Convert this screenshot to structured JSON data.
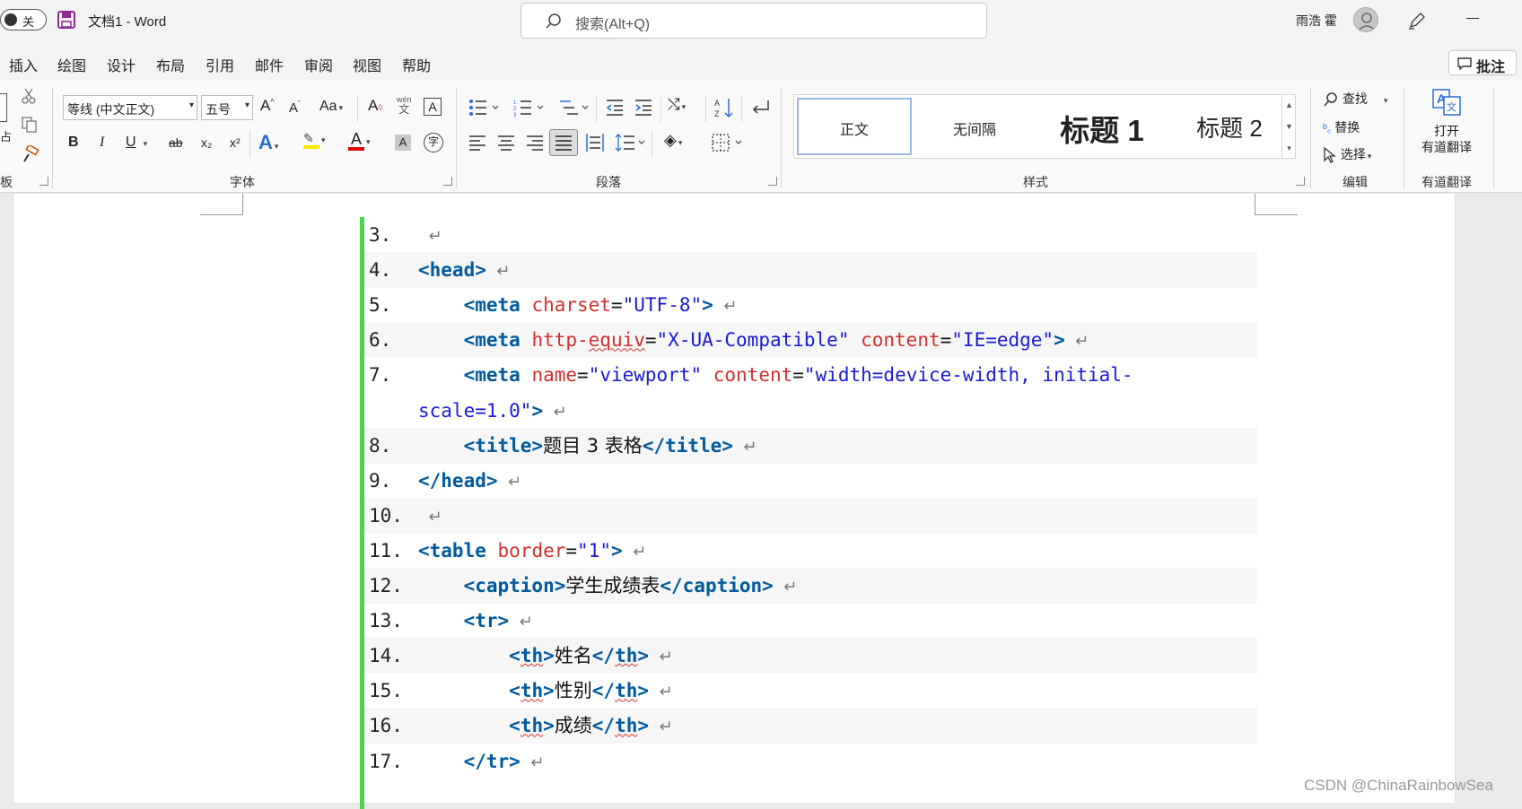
{
  "titlebar": {
    "autosave_label": "关",
    "doc_title": "文档1  -  Word",
    "search_placeholder": "搜索(Alt+Q)",
    "user_name": "雨浩 霍"
  },
  "tabs": [
    "插入",
    "绘图",
    "设计",
    "布局",
    "引用",
    "邮件",
    "审阅",
    "视图",
    "帮助"
  ],
  "comment_button": "批注",
  "ribbon": {
    "clipboard_label": "板",
    "clipboard_paste_fragment": "占",
    "font_group_label": "字体",
    "font_name": "等线 (中文正文)",
    "font_size": "五号",
    "change_case": "Aa",
    "bold": "B",
    "italic": "I",
    "underline": "U",
    "strike": "ab",
    "subscript": "x₂",
    "superscript": "x²",
    "phonetic_top": "wén",
    "phonetic_bottom": "文",
    "paragraph_group_label": "段落",
    "styles_group_label": "样式",
    "styles": [
      "正文",
      "无间隔",
      "标题 1",
      "标题 2"
    ],
    "find": "查找",
    "replace": "替换",
    "select": "选择",
    "editing_group_label": "编辑",
    "translate_line1": "打开",
    "translate_line2": "有道翻译",
    "translate_group_label": "有道翻译"
  },
  "code_lines": [
    {
      "n": "3.",
      "alt": false,
      "parts": []
    },
    {
      "n": "4.",
      "alt": true,
      "parts": [
        [
          "tg",
          "<head>"
        ]
      ]
    },
    {
      "n": "5.",
      "alt": false,
      "parts": [
        [
          "",
          "    "
        ],
        [
          "tg",
          "<meta "
        ],
        [
          "at",
          "charset"
        ],
        [
          "",
          "="
        ],
        [
          "vl",
          "\"UTF-8\""
        ],
        [
          "tg",
          ">"
        ]
      ]
    },
    {
      "n": "6.",
      "alt": true,
      "parts": [
        [
          "",
          "    "
        ],
        [
          "tg",
          "<meta "
        ],
        [
          "at",
          "http-"
        ],
        [
          "at sq",
          "equiv"
        ],
        [
          "",
          "="
        ],
        [
          "vl",
          "\"X-UA-Compatible\" "
        ],
        [
          "at",
          "content"
        ],
        [
          "",
          "="
        ],
        [
          "vl",
          "\"IE=edge\""
        ],
        [
          "tg",
          ">"
        ]
      ]
    },
    {
      "n": "7.",
      "alt": false,
      "parts": [
        [
          "",
          "    "
        ],
        [
          "tg",
          "<meta "
        ],
        [
          "at",
          "name"
        ],
        [
          "",
          "="
        ],
        [
          "vl",
          "\"viewport\" "
        ],
        [
          "at",
          "content"
        ],
        [
          "",
          "="
        ],
        [
          "vl",
          "\"width=device-width, initial-"
        ]
      ],
      "noret": true
    },
    {
      "n": "",
      "alt": false,
      "parts": [
        [
          "vl",
          "scale=1.0\""
        ],
        [
          "tg",
          ">"
        ]
      ]
    },
    {
      "n": "8.",
      "alt": true,
      "parts": [
        [
          "",
          "    "
        ],
        [
          "tg",
          "<title>"
        ],
        [
          "cn",
          "题目 3 表格"
        ],
        [
          "tg",
          "</title>"
        ]
      ]
    },
    {
      "n": "9.",
      "alt": false,
      "parts": [
        [
          "tg",
          "</head>"
        ]
      ]
    },
    {
      "n": "10.",
      "alt": true,
      "parts": []
    },
    {
      "n": "11.",
      "alt": false,
      "parts": [
        [
          "tg",
          "<table "
        ],
        [
          "at",
          "border"
        ],
        [
          "",
          "="
        ],
        [
          "vl",
          "\"1\""
        ],
        [
          "tg",
          ">"
        ]
      ]
    },
    {
      "n": "12.",
      "alt": true,
      "parts": [
        [
          "",
          "    "
        ],
        [
          "tg",
          "<caption>"
        ],
        [
          "cn",
          "学生成绩表"
        ],
        [
          "tg",
          "</caption>"
        ]
      ]
    },
    {
      "n": "13.",
      "alt": false,
      "parts": [
        [
          "",
          "    "
        ],
        [
          "tg",
          "<tr>"
        ]
      ]
    },
    {
      "n": "14.",
      "alt": true,
      "parts": [
        [
          "",
          "        "
        ],
        [
          "tg",
          "<"
        ],
        [
          "tg sq",
          "th"
        ],
        [
          "tg",
          ">"
        ],
        [
          "cn",
          "姓名"
        ],
        [
          "tg",
          "</"
        ],
        [
          "tg sq",
          "th"
        ],
        [
          "tg",
          ">"
        ]
      ]
    },
    {
      "n": "15.",
      "alt": false,
      "parts": [
        [
          "",
          "        "
        ],
        [
          "tg",
          "<"
        ],
        [
          "tg sq",
          "th"
        ],
        [
          "tg",
          ">"
        ],
        [
          "cn",
          "性别"
        ],
        [
          "tg",
          "</"
        ],
        [
          "tg sq",
          "th"
        ],
        [
          "tg",
          ">"
        ]
      ]
    },
    {
      "n": "16.",
      "alt": true,
      "parts": [
        [
          "",
          "        "
        ],
        [
          "tg",
          "<"
        ],
        [
          "tg sq",
          "th"
        ],
        [
          "tg",
          ">"
        ],
        [
          "cn",
          "成绩"
        ],
        [
          "tg",
          "</"
        ],
        [
          "tg sq",
          "th"
        ],
        [
          "tg",
          ">"
        ]
      ]
    },
    {
      "n": "17.",
      "alt": false,
      "parts": [
        [
          "",
          "    "
        ],
        [
          "tg",
          "</tr>"
        ]
      ]
    }
  ],
  "return_mark": "↵",
  "watermark": "CSDN @ChinaRainbowSea"
}
